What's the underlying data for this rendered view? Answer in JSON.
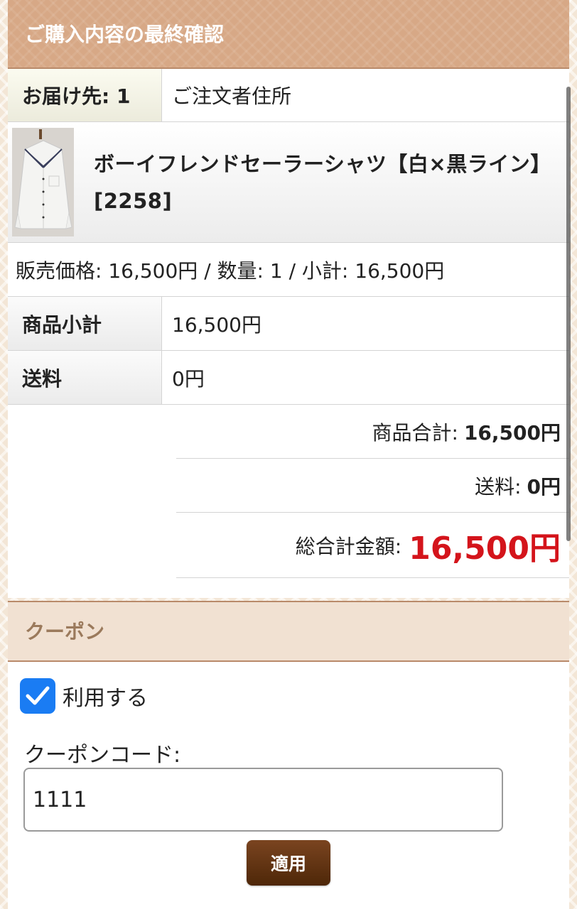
{
  "confirm": {
    "title": "ご購入内容の最終確認",
    "destination_label": "お届け先: 1",
    "destination_value": "ご注文者住所",
    "product_name": "ボーイフレンドセーラーシャツ【白×黒ライン】 [2258]",
    "price_line": "販売価格: 16,500円 / 数量: 1 / 小計: 16,500円",
    "subtotal_label": "商品小計",
    "subtotal_value": "16,500円",
    "shipping_label": "送料",
    "shipping_value": "0円",
    "goods_total_label": "商品合計:",
    "goods_total_value": "16,500円",
    "shipping_total_label": "送料:",
    "shipping_total_value": "0円",
    "grand_total_label": "総合計金額:",
    "grand_total_value": "16,500円"
  },
  "coupon": {
    "title": "クーポン",
    "use_label": "利用する",
    "use_checked": true,
    "code_label": "クーポンコード:",
    "code_value": "1111",
    "apply_label": "適用"
  },
  "colors": {
    "header_bg": "#d7a886",
    "grand_total": "#d4141b",
    "checkbox": "#1a7cf3",
    "apply_button": "#5e3212",
    "coupon_title": "#9b7a5c"
  }
}
